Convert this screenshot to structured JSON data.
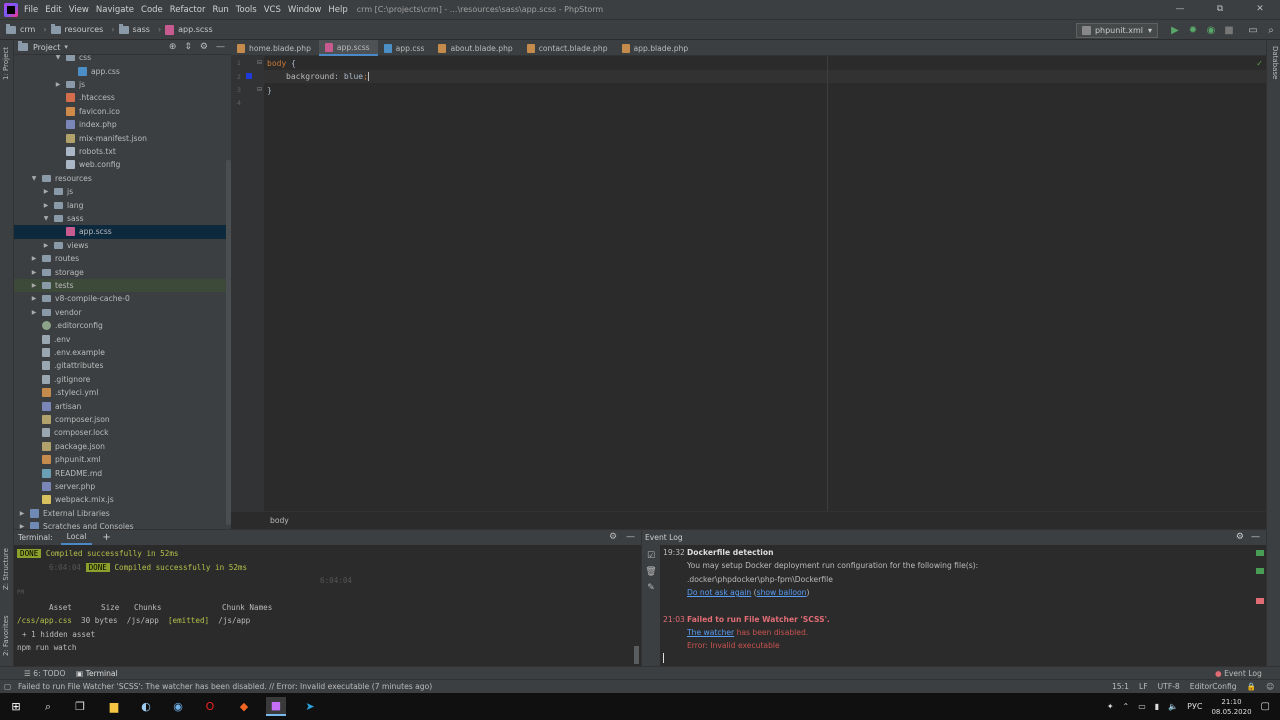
{
  "window": {
    "menu": [
      "File",
      "Edit",
      "View",
      "Navigate",
      "Code",
      "Refactor",
      "Run",
      "Tools",
      "VCS",
      "Window",
      "Help"
    ],
    "title": "crm [C:\\projects\\crm] - ...\\resources\\sass\\app.scss - PhpStorm",
    "controls": [
      "—",
      "⧉",
      "✕"
    ]
  },
  "navbar": {
    "crumbs": [
      "crm",
      "resources",
      "sass",
      "app.scss"
    ],
    "run_config": "phpunit.xml"
  },
  "left_strip": {
    "project_tab": "1: Project",
    "structure_tab": "Z: Structure",
    "favorites_tab": "2: Favorites"
  },
  "right_strip": {
    "database_tab": "Database"
  },
  "project": {
    "title": "Project",
    "tree": [
      {
        "label": "css",
        "indent": 3,
        "icon": "folder",
        "arrow": "down"
      },
      {
        "label": "app.css",
        "indent": 4,
        "icon": "css",
        "arrow": ""
      },
      {
        "label": "js",
        "indent": 3,
        "icon": "folder",
        "arrow": "right"
      },
      {
        "label": ".htaccess",
        "indent": 3,
        "icon": "git",
        "arrow": ""
      },
      {
        "label": "favicon.ico",
        "indent": 3,
        "icon": "ico",
        "arrow": ""
      },
      {
        "label": "index.php",
        "indent": 3,
        "icon": "php",
        "arrow": ""
      },
      {
        "label": "mix-manifest.json",
        "indent": 3,
        "icon": "json",
        "arrow": ""
      },
      {
        "label": "robots.txt",
        "indent": 3,
        "icon": "txt",
        "arrow": ""
      },
      {
        "label": "web.config",
        "indent": 3,
        "icon": "txt",
        "arrow": ""
      },
      {
        "label": "resources",
        "indent": 1,
        "icon": "folder",
        "arrow": "down"
      },
      {
        "label": "js",
        "indent": 2,
        "icon": "folder",
        "arrow": "right"
      },
      {
        "label": "lang",
        "indent": 2,
        "icon": "folder",
        "arrow": "right"
      },
      {
        "label": "sass",
        "indent": 2,
        "icon": "folder",
        "arrow": "down"
      },
      {
        "label": "app.scss",
        "indent": 3,
        "icon": "scss",
        "arrow": "",
        "state": "selected"
      },
      {
        "label": "views",
        "indent": 2,
        "icon": "folder",
        "arrow": "right"
      },
      {
        "label": "routes",
        "indent": 1,
        "icon": "folder",
        "arrow": "right"
      },
      {
        "label": "storage",
        "indent": 1,
        "icon": "folder",
        "arrow": "right"
      },
      {
        "label": "tests",
        "indent": 1,
        "icon": "folder",
        "arrow": "right",
        "state": "highlight"
      },
      {
        "label": "v8-compile-cache-0",
        "indent": 1,
        "icon": "folder",
        "arrow": "right"
      },
      {
        "label": "vendor",
        "indent": 1,
        "icon": "folder",
        "arrow": "right"
      },
      {
        "label": ".editorconfig",
        "indent": 1,
        "icon": "cfg",
        "arrow": ""
      },
      {
        "label": ".env",
        "indent": 1,
        "icon": "file",
        "arrow": ""
      },
      {
        "label": ".env.example",
        "indent": 1,
        "icon": "file",
        "arrow": ""
      },
      {
        "label": ".gitattributes",
        "indent": 1,
        "icon": "file",
        "arrow": ""
      },
      {
        "label": ".gitignore",
        "indent": 1,
        "icon": "file",
        "arrow": ""
      },
      {
        "label": ".styleci.yml",
        "indent": 1,
        "icon": "xml",
        "arrow": ""
      },
      {
        "label": "artisan",
        "indent": 1,
        "icon": "php",
        "arrow": ""
      },
      {
        "label": "composer.json",
        "indent": 1,
        "icon": "json",
        "arrow": ""
      },
      {
        "label": "composer.lock",
        "indent": 1,
        "icon": "file",
        "arrow": ""
      },
      {
        "label": "package.json",
        "indent": 1,
        "icon": "json",
        "arrow": ""
      },
      {
        "label": "phpunit.xml",
        "indent": 1,
        "icon": "xml",
        "arrow": ""
      },
      {
        "label": "README.md",
        "indent": 1,
        "icon": "md",
        "arrow": ""
      },
      {
        "label": "server.php",
        "indent": 1,
        "icon": "php",
        "arrow": ""
      },
      {
        "label": "webpack.mix.js",
        "indent": 1,
        "icon": "js",
        "arrow": ""
      },
      {
        "label": "External Libraries",
        "indent": 0,
        "icon": "ext",
        "arrow": "right"
      },
      {
        "label": "Scratches and Consoles",
        "indent": 0,
        "icon": "ext",
        "arrow": "right"
      }
    ]
  },
  "editor": {
    "tabs": [
      {
        "label": "home.blade.php",
        "color": "#c58b4c",
        "active": false
      },
      {
        "label": "app.scss",
        "color": "#c75a8e",
        "active": true
      },
      {
        "label": "app.css",
        "color": "#4c8fc7",
        "active": false
      },
      {
        "label": "about.blade.php",
        "color": "#c58b4c",
        "active": false
      },
      {
        "label": "contact.blade.php",
        "color": "#c58b4c",
        "active": false
      },
      {
        "label": "app.blade.php",
        "color": "#c58b4c",
        "active": false
      }
    ],
    "line_numbers": [
      "1",
      "2",
      "3",
      "4"
    ],
    "code": {
      "selector": "body",
      "open_brace": "{",
      "property": "background",
      "colon": ":",
      "value": "blue",
      "semicolon": ";",
      "close_brace": "}"
    },
    "breadcrumb": "body"
  },
  "terminal": {
    "title": "Terminal:",
    "tab": "Local",
    "done_badge": "DONE",
    "compiled_msg": "Compiled successfully in 52ms",
    "time1": "6:04:04",
    "time2": "6:04:04",
    "pm": "PM",
    "headers": [
      "Asset",
      "Size",
      "Chunks",
      "Chunk Names"
    ],
    "row": {
      "asset": "/css/app.css",
      "size": "30 bytes",
      "chunks": "/js/app",
      "emitted": "[emitted]",
      "names": "/js/app"
    },
    "hidden": "+ 1 hidden asset",
    "command": "npm run watch"
  },
  "event_log": {
    "title": "Event Log",
    "events": [
      {
        "time": "19:32",
        "title": "Dockerfile detection",
        "line1": "You may setup Docker deployment run configuration for the following file(s):",
        "line2": ".docker\\phpdocker\\php-fpm\\Dockerfile",
        "link1": "Do not ask again",
        "link2": "show balloon"
      },
      {
        "time": "21:03",
        "title": "Failed to run File Watcher 'SCSS'.",
        "link": "The watcher",
        "rest": "has been disabled.",
        "error": "Error: Invalid executable"
      }
    ]
  },
  "bottom_tabs": {
    "todo": "6: TODO",
    "terminal": "Terminal",
    "event_log": "Event Log"
  },
  "status": {
    "message": "Failed to run File Watcher 'SCSS': The watcher has been disabled. // Error: Invalid executable (7 minutes ago)",
    "position": "15:1",
    "line_sep": "LF",
    "encoding": "UTF-8",
    "editorconfig": "EditorConfig"
  },
  "taskbar": {
    "lang": "РУС",
    "time": "21:10",
    "date": "08.05.2020"
  }
}
